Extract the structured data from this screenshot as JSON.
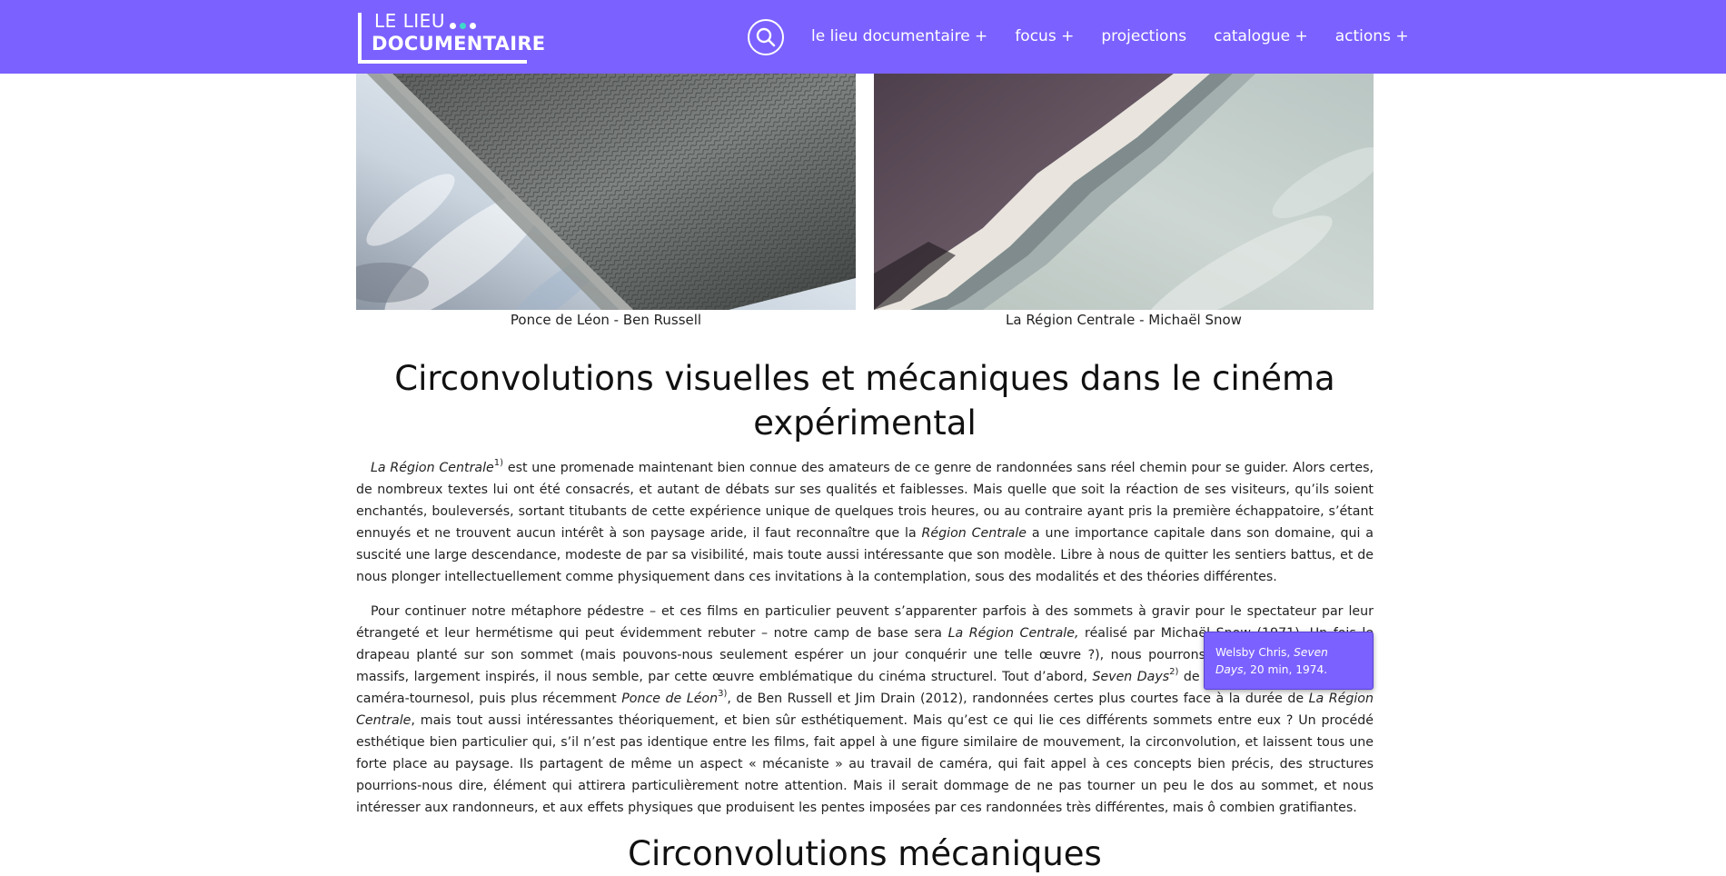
{
  "header": {
    "logo": {
      "line1": "LE LIEU",
      "line2": "DOCUMENTAIRE",
      "dot_colors": [
        "#ffffff",
        "#3fd9c9",
        "#ffffff"
      ]
    },
    "search_icon": "search-icon",
    "nav": [
      {
        "label": "le lieu documentaire +"
      },
      {
        "label": "focus +"
      },
      {
        "label": "projections"
      },
      {
        "label": "catalogue +"
      },
      {
        "label": "actions +"
      }
    ],
    "background_color": "#7b61ff"
  },
  "images": [
    {
      "caption": "Ponce de Léon - Ben Russell"
    },
    {
      "caption": "La Région Centrale - Michaël Snow"
    }
  ],
  "article": {
    "title": "Circonvolutions visuelles et mécaniques dans le cinéma expérimental",
    "p1": {
      "em1": "La Région Centrale",
      "sup1": "1)",
      "t1": "  est une promenade maintenant bien connue des amateurs de ce genre de randonnées sans réel chemin pour se guider. Alors certes, de nombreux textes lui ont été consacrés, et autant de débats sur ses qualités et faiblesses. Mais quelle que soit la réaction de ses visiteurs, qu’ils soient enchantés, bouleversés, sortant titubants de cette expérience unique de quelques trois heures, ou au contraire ayant pris la première échappatoire, s’étant ennuyés et ne trouvent aucun intérêt à son paysage aride, il faut reconnaître que la ",
      "em2": "Région Centrale",
      "t2": "  a une importance capitale dans son domaine, qui a suscité une large descendance, modeste de par sa visibilité, mais toute aussi intéressante que son modèle. Libre à nous de quitter les sentiers battus, et de nous plonger intellectuellement comme physiquement dans ces invitations à la contemplation, sous des modalités et des théories différentes."
    },
    "p2": {
      "t1": "Pour continuer notre métaphore pédestre – et ces films en particulier peuvent s’apparenter parfois à des sommets à gravir pour le spectateur par leur étrangeté et leur hermétisme qui peut évidemment rebuter – notre camp de base sera  ",
      "em1": "La Région Centrale,",
      "t2": "  réalisé par Michaël Snow (1971). Un fois le drapeau planté sur son sommet (mais pouvons-nous seulement espérer un jour conquérir une telle œuvre  ?), nous pourrons descendre vers d’autres massifs, largement inspirés, il nous semble, par cette œuvre emblématique du cinéma structurel. Tout d’abord,  ",
      "em2": "Seven Days",
      "sup2": "2)",
      "t3": " de Chris Welsby (1974) et sa caméra-tournesol, puis plus récemment  ",
      "em3": "Ponce de Léon",
      "sup3": "3)",
      "t4": ", de Ben Russell et Jim Drain (2012), randonnées certes plus courtes face à la durée de  ",
      "em4": "La Région Centrale",
      "t5": ", mais tout aussi intéressantes théoriquement, et bien sûr esthétiquement. Mais qu’est ce qui lie ces différents sommets entre eux  ? Un procédé esthétique bien particulier qui, s’il n’est pas identique entre les films, fait appel à une figure similaire de mouvement, la circonvolution, et laissent tous une forte place au paysage. Ils partagent de même un aspect «  mécaniste  » au travail de caméra, qui fait appel à ces concepts bien précis, des structures pourrions-nous dire, élément qui attirera particulièrement notre attention. Mais il serait dommage de ne pas tourner un peu le dos au sommet, et nous intéresser aux randonneurs, et aux effets physiques que produisent les pentes imposées par ces randonnées très différentes, mais ô combien gratifiantes."
    },
    "subtitle": "Circonvolutions mécaniques"
  },
  "tooltip": {
    "t1": "Welsby Chris, ",
    "em": "Seven Days",
    "t2": ", 20 min, 1974."
  }
}
